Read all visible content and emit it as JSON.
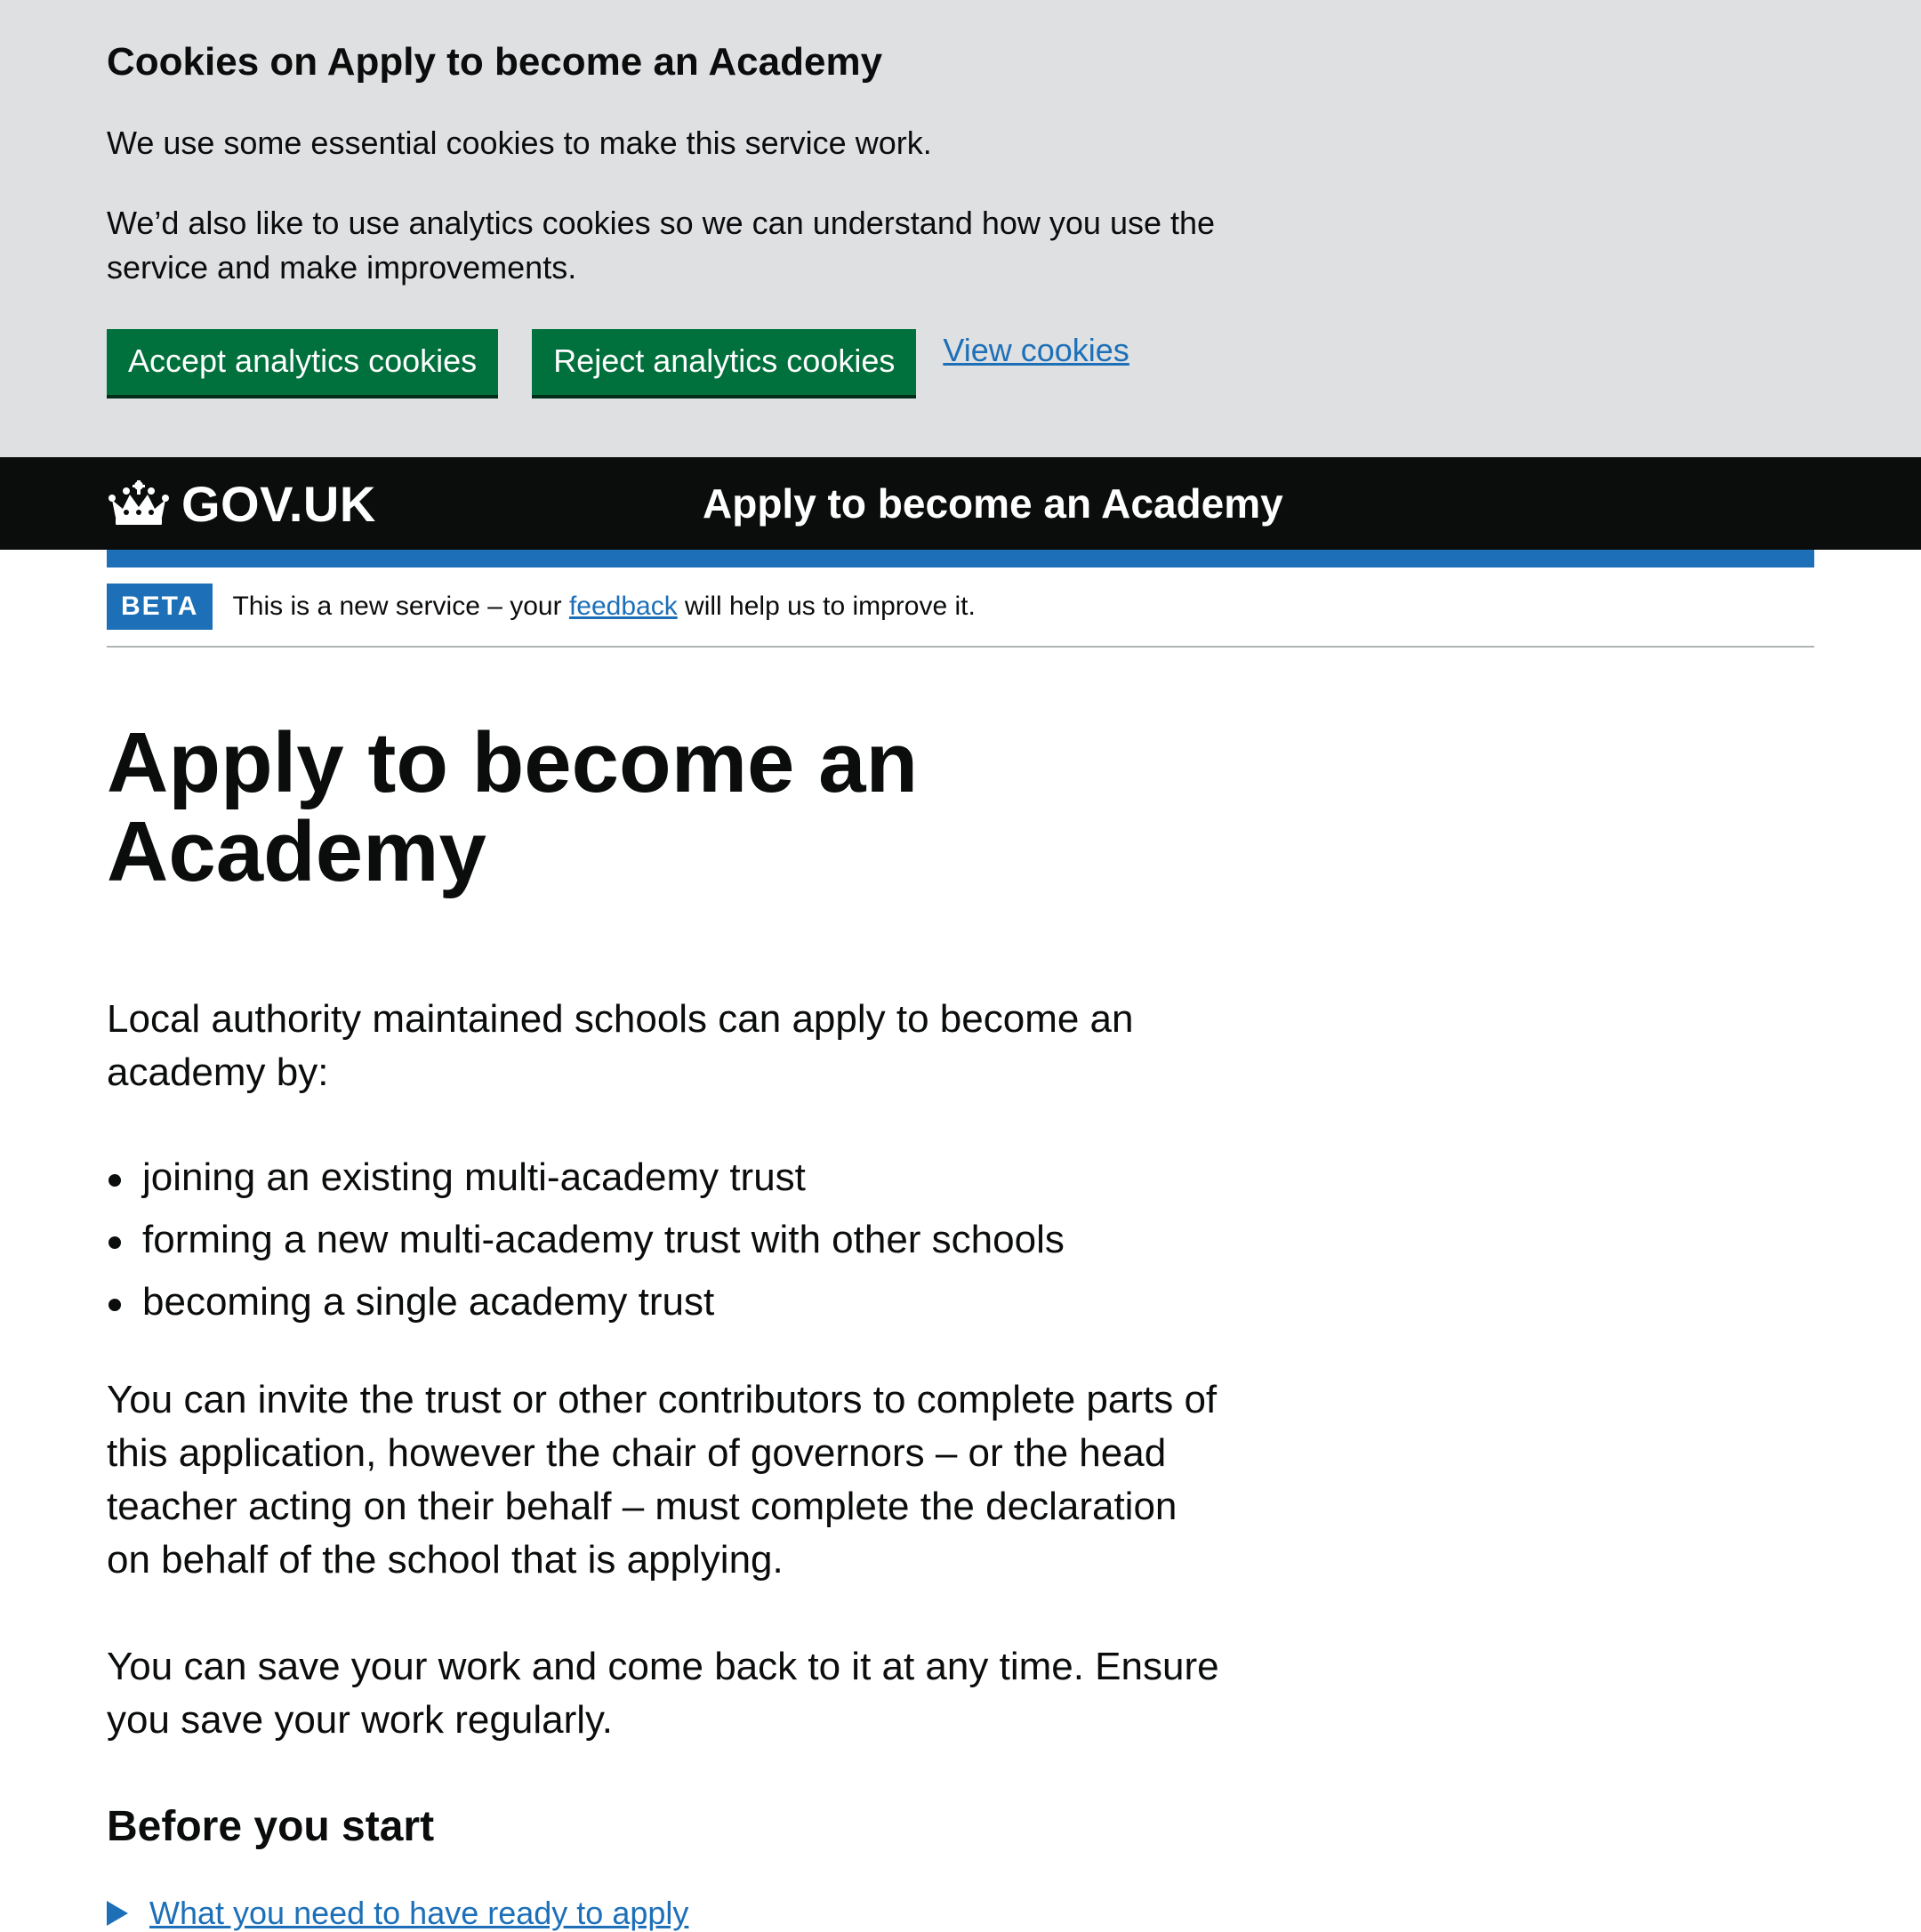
{
  "cookie_banner": {
    "heading": "Cookies on Apply to become an Academy",
    "paragraph1": "We use some essential cookies to make this service work.",
    "paragraph2": "We’d also like to use analytics cookies so we can understand how you use the service and make improvements.",
    "accept_label": "Accept analytics cookies",
    "reject_label": "Reject analytics cookies",
    "view_label": "View cookies"
  },
  "header": {
    "logo_text": "GOV.UK",
    "service_name": "Apply to become an Academy"
  },
  "phase_banner": {
    "tag": "BETA",
    "text_before": "This is a new service – your ",
    "link_text": "feedback",
    "text_after": " will help us to improve it."
  },
  "main": {
    "title": "Apply to become an Academy",
    "lead": "Local authority maintained schools can apply to become an academy by:",
    "bullets": [
      "joining an existing multi-academy trust",
      "forming a new multi-academy trust with other schools",
      "becoming a single academy trust"
    ],
    "para_invite": "You can invite the trust or other contributors to complete parts of this application, however the chair of governors – or the head teacher acting on their behalf – must complete the declaration on behalf of the school that is applying.",
    "para_save": "You can save your work and come back to it at any time. Ensure you save your work regularly.",
    "before_heading": "Before you start",
    "details_summary": "What you need to have ready to apply"
  },
  "colors": {
    "banner_bg": "#dfe0e2",
    "button_green": "#00703c",
    "link_blue": "#1d70b8",
    "header_black": "#0b0c0c"
  },
  "icons": {
    "logo": "crown-icon",
    "details": "triangle-right-icon"
  }
}
